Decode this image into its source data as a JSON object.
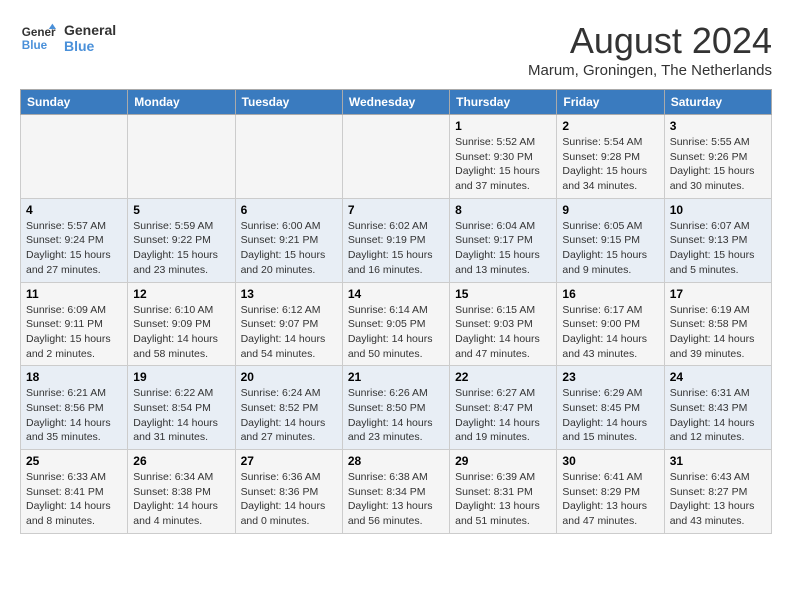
{
  "header": {
    "logo_line1": "General",
    "logo_line2": "Blue",
    "month_year": "August 2024",
    "location": "Marum, Groningen, The Netherlands"
  },
  "weekdays": [
    "Sunday",
    "Monday",
    "Tuesday",
    "Wednesday",
    "Thursday",
    "Friday",
    "Saturday"
  ],
  "weeks": [
    [
      {
        "day": "",
        "info": ""
      },
      {
        "day": "",
        "info": ""
      },
      {
        "day": "",
        "info": ""
      },
      {
        "day": "",
        "info": ""
      },
      {
        "day": "1",
        "info": "Sunrise: 5:52 AM\nSunset: 9:30 PM\nDaylight: 15 hours\nand 37 minutes."
      },
      {
        "day": "2",
        "info": "Sunrise: 5:54 AM\nSunset: 9:28 PM\nDaylight: 15 hours\nand 34 minutes."
      },
      {
        "day": "3",
        "info": "Sunrise: 5:55 AM\nSunset: 9:26 PM\nDaylight: 15 hours\nand 30 minutes."
      }
    ],
    [
      {
        "day": "4",
        "info": "Sunrise: 5:57 AM\nSunset: 9:24 PM\nDaylight: 15 hours\nand 27 minutes."
      },
      {
        "day": "5",
        "info": "Sunrise: 5:59 AM\nSunset: 9:22 PM\nDaylight: 15 hours\nand 23 minutes."
      },
      {
        "day": "6",
        "info": "Sunrise: 6:00 AM\nSunset: 9:21 PM\nDaylight: 15 hours\nand 20 minutes."
      },
      {
        "day": "7",
        "info": "Sunrise: 6:02 AM\nSunset: 9:19 PM\nDaylight: 15 hours\nand 16 minutes."
      },
      {
        "day": "8",
        "info": "Sunrise: 6:04 AM\nSunset: 9:17 PM\nDaylight: 15 hours\nand 13 minutes."
      },
      {
        "day": "9",
        "info": "Sunrise: 6:05 AM\nSunset: 9:15 PM\nDaylight: 15 hours\nand 9 minutes."
      },
      {
        "day": "10",
        "info": "Sunrise: 6:07 AM\nSunset: 9:13 PM\nDaylight: 15 hours\nand 5 minutes."
      }
    ],
    [
      {
        "day": "11",
        "info": "Sunrise: 6:09 AM\nSunset: 9:11 PM\nDaylight: 15 hours\nand 2 minutes."
      },
      {
        "day": "12",
        "info": "Sunrise: 6:10 AM\nSunset: 9:09 PM\nDaylight: 14 hours\nand 58 minutes."
      },
      {
        "day": "13",
        "info": "Sunrise: 6:12 AM\nSunset: 9:07 PM\nDaylight: 14 hours\nand 54 minutes."
      },
      {
        "day": "14",
        "info": "Sunrise: 6:14 AM\nSunset: 9:05 PM\nDaylight: 14 hours\nand 50 minutes."
      },
      {
        "day": "15",
        "info": "Sunrise: 6:15 AM\nSunset: 9:03 PM\nDaylight: 14 hours\nand 47 minutes."
      },
      {
        "day": "16",
        "info": "Sunrise: 6:17 AM\nSunset: 9:00 PM\nDaylight: 14 hours\nand 43 minutes."
      },
      {
        "day": "17",
        "info": "Sunrise: 6:19 AM\nSunset: 8:58 PM\nDaylight: 14 hours\nand 39 minutes."
      }
    ],
    [
      {
        "day": "18",
        "info": "Sunrise: 6:21 AM\nSunset: 8:56 PM\nDaylight: 14 hours\nand 35 minutes."
      },
      {
        "day": "19",
        "info": "Sunrise: 6:22 AM\nSunset: 8:54 PM\nDaylight: 14 hours\nand 31 minutes."
      },
      {
        "day": "20",
        "info": "Sunrise: 6:24 AM\nSunset: 8:52 PM\nDaylight: 14 hours\nand 27 minutes."
      },
      {
        "day": "21",
        "info": "Sunrise: 6:26 AM\nSunset: 8:50 PM\nDaylight: 14 hours\nand 23 minutes."
      },
      {
        "day": "22",
        "info": "Sunrise: 6:27 AM\nSunset: 8:47 PM\nDaylight: 14 hours\nand 19 minutes."
      },
      {
        "day": "23",
        "info": "Sunrise: 6:29 AM\nSunset: 8:45 PM\nDaylight: 14 hours\nand 15 minutes."
      },
      {
        "day": "24",
        "info": "Sunrise: 6:31 AM\nSunset: 8:43 PM\nDaylight: 14 hours\nand 12 minutes."
      }
    ],
    [
      {
        "day": "25",
        "info": "Sunrise: 6:33 AM\nSunset: 8:41 PM\nDaylight: 14 hours\nand 8 minutes."
      },
      {
        "day": "26",
        "info": "Sunrise: 6:34 AM\nSunset: 8:38 PM\nDaylight: 14 hours\nand 4 minutes."
      },
      {
        "day": "27",
        "info": "Sunrise: 6:36 AM\nSunset: 8:36 PM\nDaylight: 14 hours\nand 0 minutes."
      },
      {
        "day": "28",
        "info": "Sunrise: 6:38 AM\nSunset: 8:34 PM\nDaylight: 13 hours\nand 56 minutes."
      },
      {
        "day": "29",
        "info": "Sunrise: 6:39 AM\nSunset: 8:31 PM\nDaylight: 13 hours\nand 51 minutes."
      },
      {
        "day": "30",
        "info": "Sunrise: 6:41 AM\nSunset: 8:29 PM\nDaylight: 13 hours\nand 47 minutes."
      },
      {
        "day": "31",
        "info": "Sunrise: 6:43 AM\nSunset: 8:27 PM\nDaylight: 13 hours\nand 43 minutes."
      }
    ]
  ]
}
